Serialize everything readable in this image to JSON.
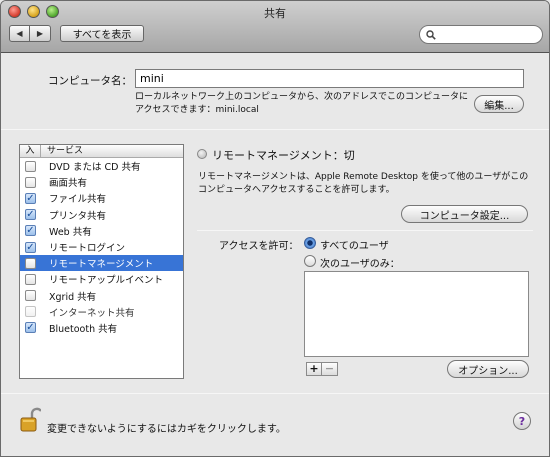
{
  "window": {
    "title": "共有"
  },
  "toolbar": {
    "back_glyph": "◀",
    "forward_glyph": "▶",
    "show_all_label": "すべてを表示",
    "search_placeholder": ""
  },
  "computer_name": {
    "label": "コンピュータ名：",
    "value": "mini",
    "description": "ローカルネットワーク上のコンピュータから、次のアドレスでこのコンピュータにアクセスできます：mini.local",
    "edit_label": "編集..."
  },
  "services": {
    "header_on": "入",
    "header_service": "サービス",
    "items": [
      {
        "label": "DVD または CD 共有",
        "checked": false,
        "enabled": true
      },
      {
        "label": "画面共有",
        "checked": false,
        "enabled": true
      },
      {
        "label": "ファイル共有",
        "checked": true,
        "enabled": true
      },
      {
        "label": "プリンタ共有",
        "checked": true,
        "enabled": true
      },
      {
        "label": "Web 共有",
        "checked": true,
        "enabled": true
      },
      {
        "label": "リモートログイン",
        "checked": true,
        "enabled": true
      },
      {
        "label": "リモートマネージメント",
        "checked": false,
        "enabled": true,
        "selected": true
      },
      {
        "label": "リモートアップルイベント",
        "checked": false,
        "enabled": true
      },
      {
        "label": "Xgrid 共有",
        "checked": false,
        "enabled": true
      },
      {
        "label": "インターネット共有",
        "checked": false,
        "enabled": false
      },
      {
        "label": "Bluetooth 共有",
        "checked": true,
        "enabled": true
      }
    ]
  },
  "detail": {
    "status": "リモートマネージメント：切",
    "description": "リモートマネージメントは、Apple Remote Desktop を使って他のユーザがこのコンピュータへアクセスすることを許可します。",
    "computer_settings_label": "コンピュータ設定...",
    "access_label": "アクセスを許可：",
    "radio_all": "すべてのユーザ",
    "radio_only": "次のユーザのみ：",
    "plus": "+",
    "minus": "−",
    "options_label": "オプション..."
  },
  "footer": {
    "lock_text": "変更できないようにするにはカギをクリックします。",
    "help_glyph": "?"
  },
  "colors": {
    "selection": "#3874d6",
    "help_mark": "#6a2b9e"
  }
}
